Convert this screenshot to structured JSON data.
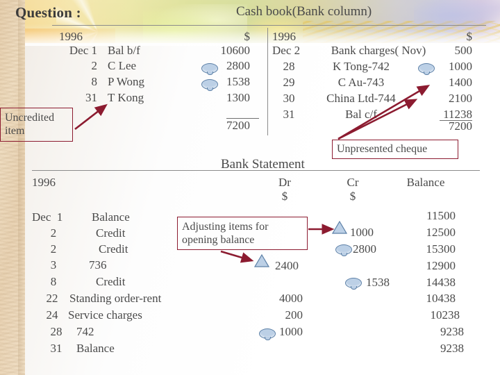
{
  "slide": {
    "question_label": "Question :",
    "cashbook_title": "Cash book(Bank column)",
    "bankstatement_title": "Bank Statement"
  },
  "cashbook": {
    "left": {
      "year": "1996",
      "amount_header": "$",
      "rows": [
        {
          "date": "Dec 1",
          "detail": "Bal b/f",
          "marker": "",
          "amount": "10600"
        },
        {
          "date": "2",
          "detail": "C Lee",
          "marker": "oval",
          "amount": "2800"
        },
        {
          "date": "8",
          "detail": "P Wong",
          "marker": "oval",
          "amount": "1538"
        },
        {
          "date": "31",
          "detail": "T Kong",
          "marker": "",
          "amount": "1300"
        }
      ],
      "total": "7200"
    },
    "right": {
      "year": "1996",
      "amount_header": "$",
      "rows": [
        {
          "date": "Dec 2",
          "detail": "Bank charges( Nov)",
          "marker": "",
          "amount": "500"
        },
        {
          "date": "28",
          "detail": "K Tong-742",
          "marker": "oval",
          "amount": "1000"
        },
        {
          "date": "29",
          "detail": "C Au-743",
          "marker": "",
          "amount": "1400"
        },
        {
          "date": "30",
          "detail": "China Ltd-744",
          "marker": "",
          "amount": "2100"
        },
        {
          "date": "31",
          "detail": "Bal c/f",
          "marker": "",
          "amount": "11238"
        }
      ],
      "total": "7200"
    }
  },
  "statement": {
    "year": "1996",
    "columns": {
      "dr": "Dr",
      "cr": "Cr",
      "balance": "Balance",
      "dr_unit": "$",
      "cr_unit": "$"
    },
    "rows": [
      {
        "date": "Dec  1",
        "detail": "Balance",
        "dr": "",
        "dr_marker": "",
        "cr": "",
        "cr_marker": "",
        "balance": "11500"
      },
      {
        "date": "2",
        "detail": "Credit",
        "dr": "",
        "dr_marker": "",
        "cr": "1000",
        "cr_marker": "tri",
        "balance": "12500"
      },
      {
        "date": "2",
        "detail": "Credit",
        "dr": "",
        "dr_marker": "",
        "cr": "2800",
        "cr_marker": "oval",
        "balance": "15300"
      },
      {
        "date": "3",
        "detail": "736",
        "dr": "2400",
        "dr_marker": "tri",
        "cr": "",
        "cr_marker": "",
        "balance": "12900"
      },
      {
        "date": "8",
        "detail": "Credit",
        "dr": "",
        "dr_marker": "",
        "cr": "1538",
        "cr_marker": "oval",
        "balance": "14438"
      },
      {
        "date": "22",
        "detail": "Standing order-rent",
        "dr": "4000",
        "dr_marker": "",
        "cr": "",
        "cr_marker": "",
        "balance": "10438"
      },
      {
        "date": "24",
        "detail": "Service charges",
        "dr": "200",
        "dr_marker": "",
        "cr": "",
        "cr_marker": "",
        "balance": "10238"
      },
      {
        "date": "28",
        "detail": "742",
        "dr": "1000",
        "dr_marker": "oval",
        "cr": "",
        "cr_marker": "",
        "balance": "9238"
      },
      {
        "date": "31",
        "detail": "Balance",
        "dr": "",
        "dr_marker": "",
        "cr": "",
        "cr_marker": "",
        "balance": "9238"
      }
    ]
  },
  "callouts": {
    "uncredited": "Uncredited\nitem",
    "unpresented": "Unpresented cheque",
    "adjusting": "Adjusting items for\nopening balance"
  },
  "colors": {
    "callout_border": "#8c1b30",
    "arrow": "#8c1b30",
    "text": "#4a4a4a",
    "marker_fill": "#bcd0e6",
    "marker_stroke": "#5b7fa6"
  }
}
